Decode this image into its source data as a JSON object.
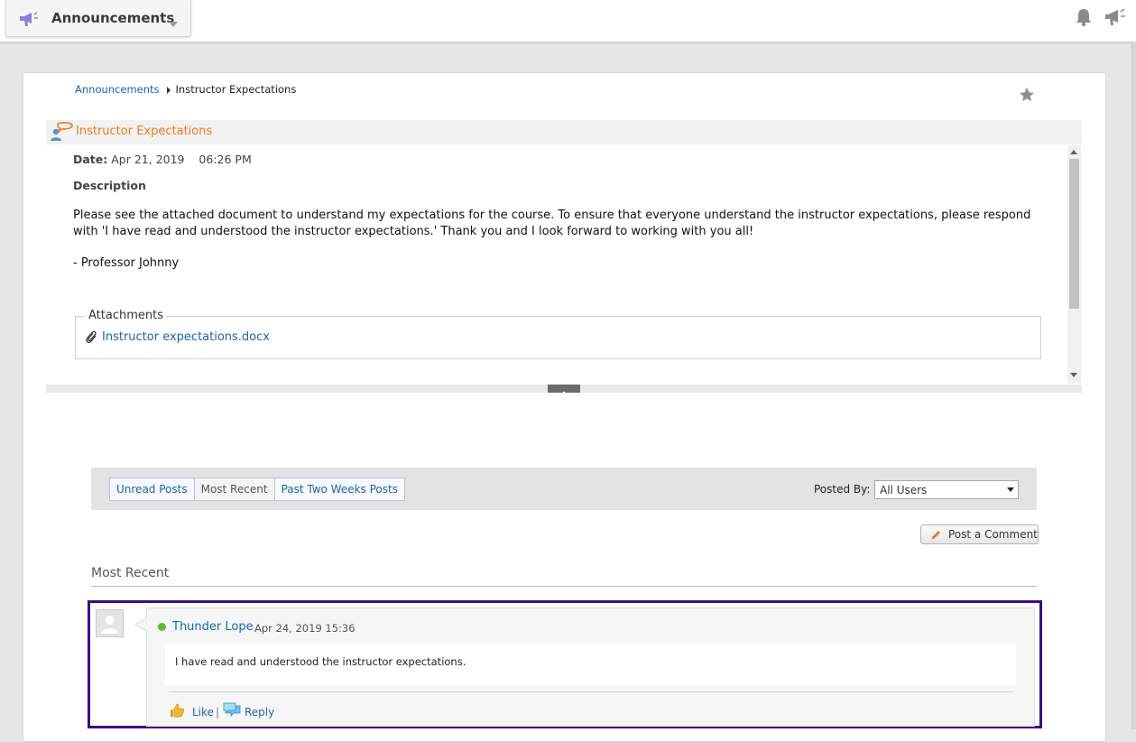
{
  "topbar": {
    "module_title": "Announcements",
    "icons": [
      "megaphone-icon",
      "chevron-down-icon",
      "bell-icon",
      "announcement-icon"
    ]
  },
  "breadcrumb": {
    "parent": "Announcements",
    "current": "Instructor Expectations"
  },
  "announcement": {
    "title": "Instructor Expectations",
    "date_label": "Date:",
    "date": "Apr 21, 2019",
    "time": "06:26 PM",
    "description_label": "Description",
    "body": "Please see the attached document to understand my expectations for the course. To ensure that everyone understand the instructor expectations, please respond with 'I have read and understood the instructor expectations.' Thank you and I look forward to working with you all!",
    "signature": "- Professor Johnny",
    "attachments_label": "Attachments",
    "attachment_file": "Instructor expectations.docx"
  },
  "filters": {
    "tabs": [
      {
        "label": "Unread Posts",
        "active": false
      },
      {
        "label": "Most Recent",
        "active": true
      },
      {
        "label": "Past Two Weeks Posts",
        "active": false
      }
    ],
    "posted_by_label": "Posted By:",
    "posted_by_value": "All Users"
  },
  "post_comment_label": "Post a Comment",
  "section_title": "Most Recent",
  "comment": {
    "author": "Thunder Lope",
    "timestamp": "Apr 24, 2019 15:36",
    "text": "I have read and understood the instructor expectations.",
    "like_label": "Like",
    "separator": "|",
    "reply_label": "Reply"
  },
  "colors": {
    "link": "#1d64a8",
    "title_orange": "#ee7a1c",
    "highlight_outline": "#3b0e7d",
    "online_status": "#6bb13d"
  }
}
